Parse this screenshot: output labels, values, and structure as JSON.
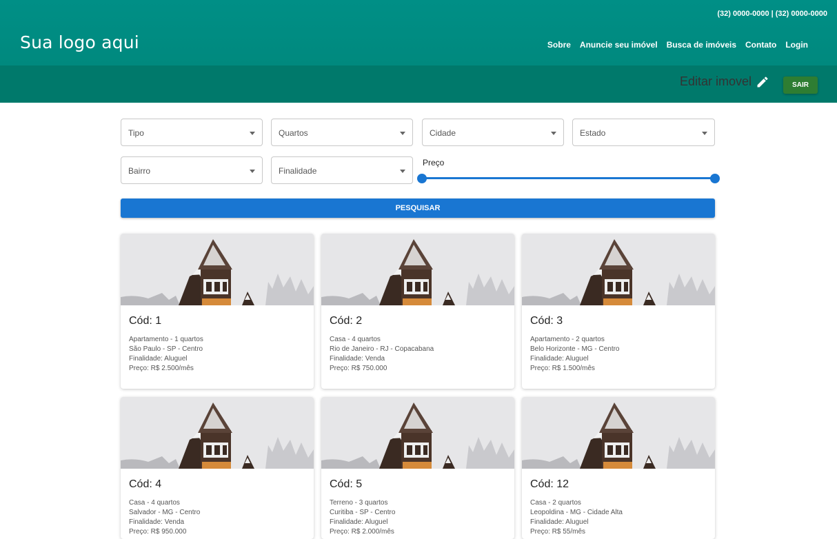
{
  "header": {
    "phones": "(32) 0000-0000 | (32) 0000-0000",
    "logo": "Sua logo aqui",
    "nav": [
      "Sobre",
      "Anuncie seu imóvel",
      "Busca de imóveis",
      "Contato",
      "Login"
    ]
  },
  "subheader": {
    "edit_label": "Editar imovel",
    "sair_label": "SAIR"
  },
  "filters": {
    "tipo": "Tipo",
    "quartos": "Quartos",
    "cidade": "Cidade",
    "estado": "Estado",
    "bairro": "Bairro",
    "finalidade": "Finalidade",
    "preco_label": "Preço",
    "preco_range": [
      0,
      1
    ],
    "search_label": "PESQUISAR"
  },
  "listings": [
    {
      "code": "Cód: 1",
      "type": "Apartamento - 1 quartos",
      "location": "São Paulo - SP - Centro",
      "purpose": "Finalidade: Aluguel",
      "price": "Preço: R$ 2.500/mês"
    },
    {
      "code": "Cód: 2",
      "type": "Casa - 4 quartos",
      "location": "Rio de Janeiro - RJ - Copacabana",
      "purpose": "Finalidade: Venda",
      "price": "Preço: R$ 750.000"
    },
    {
      "code": "Cód: 3",
      "type": "Apartamento - 2 quartos",
      "location": "Belo Horizonte - MG - Centro",
      "purpose": "Finalidade: Aluguel",
      "price": "Preço: R$ 1.500/mês"
    },
    {
      "code": "Cód: 4",
      "type": "Casa - 4 quartos",
      "location": "Salvador - MG - Centro",
      "purpose": "Finalidade: Venda",
      "price": "Preço: R$ 950.000"
    },
    {
      "code": "Cód: 5",
      "type": "Terreno - 3 quartos",
      "location": "Curitiba - SP - Centro",
      "purpose": "Finalidade: Aluguel",
      "price": "Preço: R$ 2.000/mês"
    },
    {
      "code": "Cód: 12",
      "type": "Casa - 2 quartos",
      "location": "Leopoldina - MG - Cidade Alta",
      "purpose": "Finalidade: Aluguel",
      "price": "Preço: R$ 55/mês"
    }
  ]
}
